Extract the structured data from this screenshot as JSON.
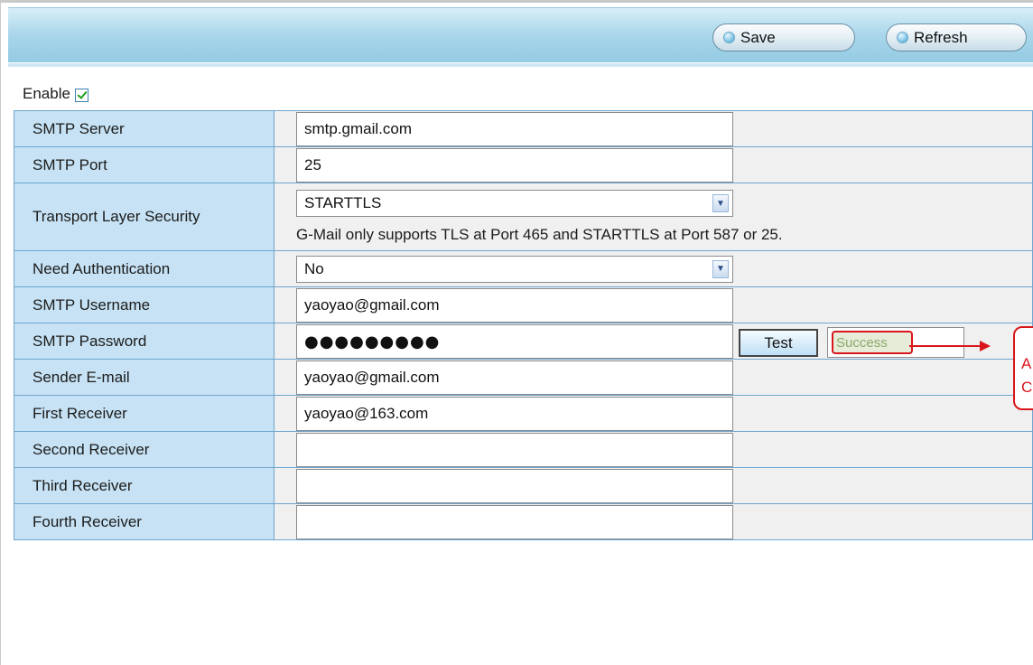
{
  "toolbar": {
    "save_label": "Save",
    "refresh_label": "Refresh"
  },
  "enable": {
    "label": "Enable",
    "checked": true
  },
  "fields": {
    "smtp_server": {
      "label": "SMTP Server",
      "value": "smtp.gmail.com"
    },
    "smtp_port": {
      "label": "SMTP Port",
      "value": "25"
    },
    "tls": {
      "label": "Transport Layer Security",
      "value": "STARTTLS",
      "hint": "G-Mail only supports TLS at Port 465 and STARTTLS at Port 587 or 25."
    },
    "need_auth": {
      "label": "Need Authentication",
      "value": "No"
    },
    "smtp_username": {
      "label": "SMTP Username",
      "value": "yaoyao@gmail.com"
    },
    "smtp_password": {
      "label": "SMTP Password",
      "value": "●●●●●●●●●",
      "test_label": "Test",
      "test_result": "Success"
    },
    "sender_email": {
      "label": "Sender E-mail",
      "value": "yaoyao@gmail.com"
    },
    "first_receiver": {
      "label": "First Receiver",
      "value": "yaoyao@163.com"
    },
    "second_receiver": {
      "label": "Second Receiver",
      "value": ""
    },
    "third_receiver": {
      "label": "Third Receiver",
      "value": ""
    },
    "fourth_receiver": {
      "label": "Fourth Receiver",
      "value": ""
    }
  },
  "annotation": {
    "line1": "A",
    "line2": "C"
  },
  "colors": {
    "label_bg": "#c6e2f4",
    "value_bg": "#f0f0f0",
    "annotation_red": "#d9161c",
    "border_blue": "#6fa6cf"
  }
}
